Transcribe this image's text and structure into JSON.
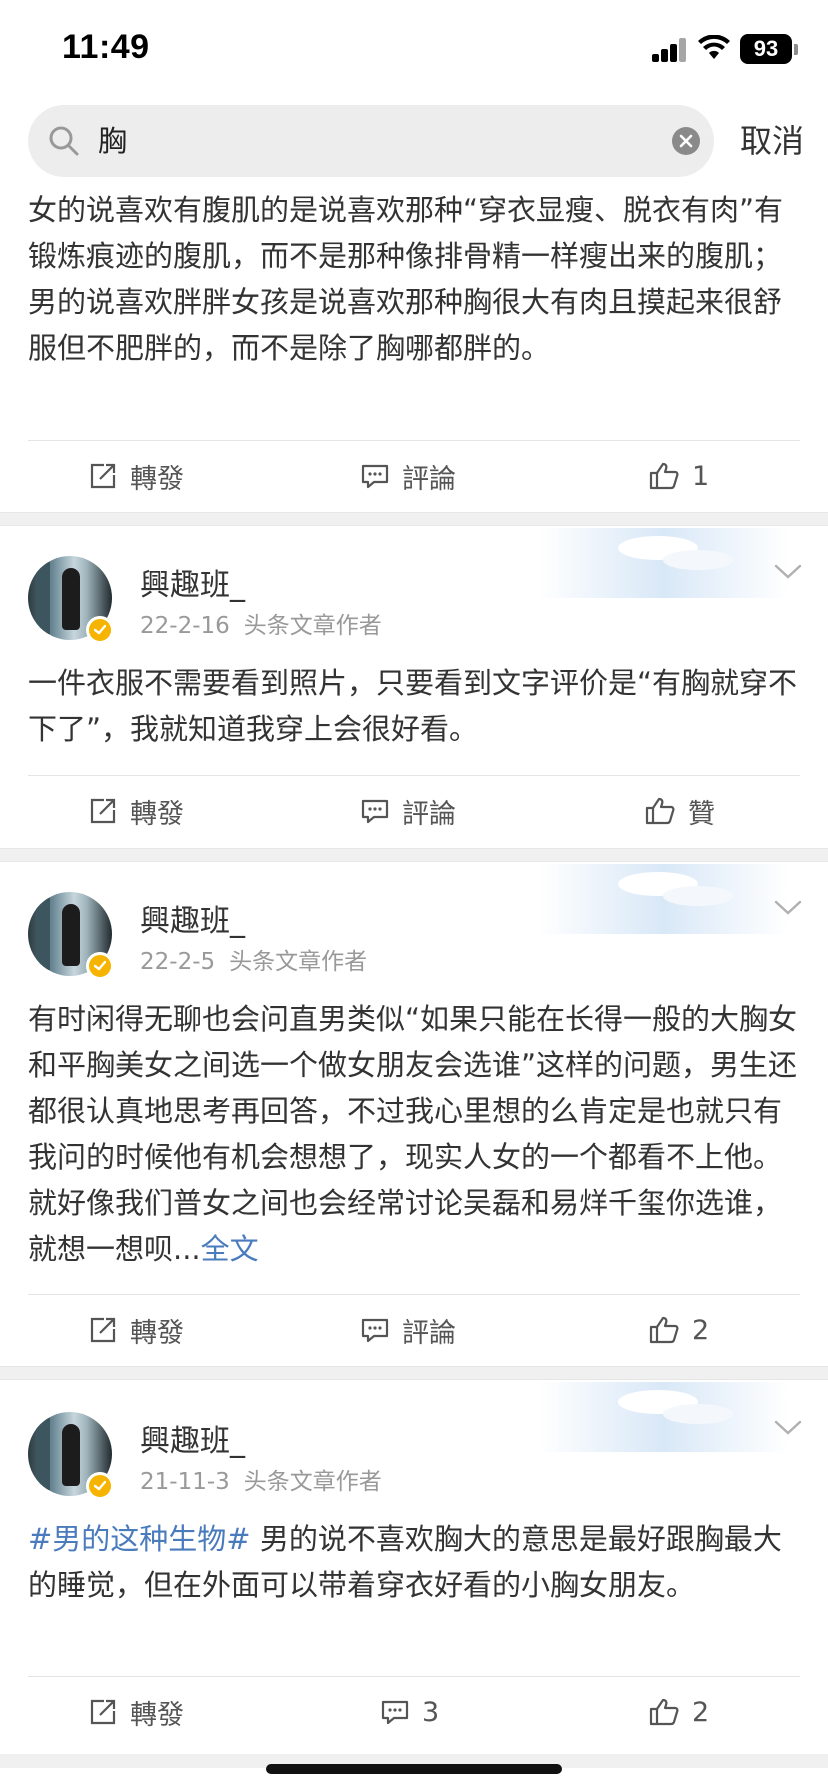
{
  "status_bar": {
    "time": "11:49",
    "battery": "93"
  },
  "search": {
    "query": "胸",
    "cancel_label": "取消"
  },
  "action_labels": {
    "repost": "轉發",
    "comment": "評論"
  },
  "posts": [
    {
      "text": "女的说喜欢有腹肌的是说喜欢那种“穿衣显瘦、脱衣有肉”有锻炼痕迹的腹肌，而不是那种像排骨精一样瘦出来的腹肌；男的说喜欢胖胖女孩是说喜欢那种胸很大有肉且摸起来很舒服但不肥胖的，而不是除了胸哪都胖的。",
      "comment_count": "評論",
      "like_count": "1"
    },
    {
      "username": "興趣班_",
      "date": "22-2-16",
      "role": "头条文章作者",
      "text": "一件衣服不需要看到照片，只要看到文字评价是“有胸就穿不下了”，我就知道我穿上会很好看。",
      "comment_count": "評論",
      "like_count": "贊"
    },
    {
      "username": "興趣班_",
      "date": "22-2-5",
      "role": "头条文章作者",
      "text": "有时闲得无聊也会问直男类似“如果只能在长得一般的大胸女和平胸美女之间选一个做女朋友会选谁”这样的问题，男生还都很认真地思考再回答，不过我心里想的么肯定是也就只有我问的时候他有机会想想了，现实人女的一个都看不上他。就好像我们普女之间也会经常讨论吴磊和易烊千玺你选谁，就想一想呗...",
      "full_text_link": "全文",
      "comment_count": "評論",
      "like_count": "2"
    },
    {
      "username": "興趣班_",
      "date": "21-11-3",
      "role": "头条文章作者",
      "hashtag": "#男的这种生物#",
      "text": " 男的说不喜欢胸大的意思是最好跟胸最大的睡觉，但在外面可以带着穿衣好看的小胸女朋友。",
      "comment_count": "3",
      "like_count": "2"
    }
  ],
  "colors": {
    "link": "#4a7bbd",
    "meta": "#999999",
    "verified": "#f6b400"
  }
}
